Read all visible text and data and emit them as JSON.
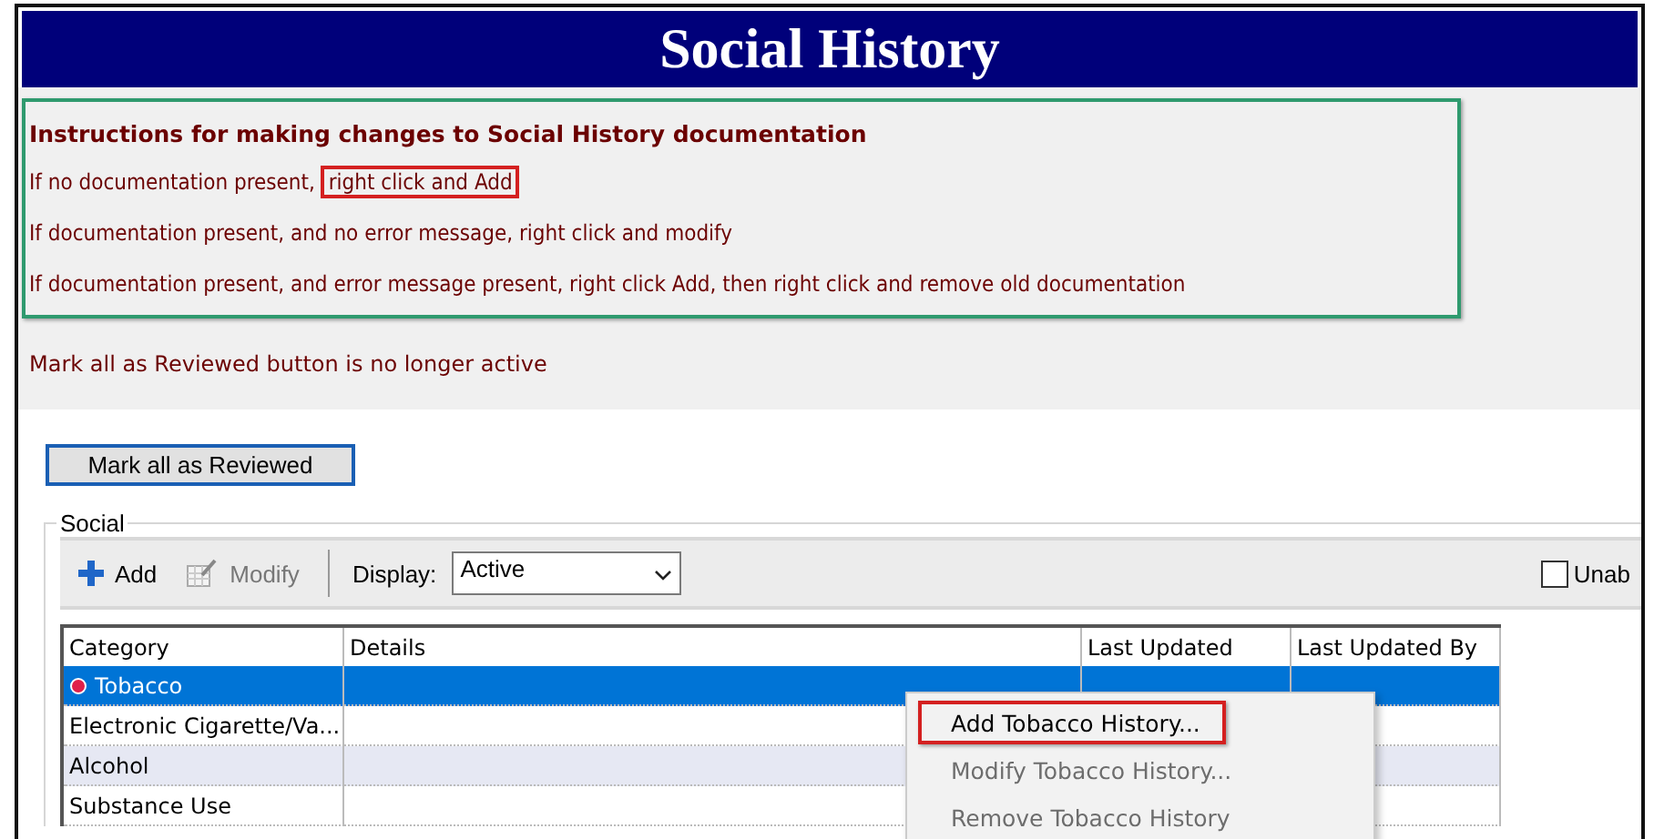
{
  "window": {
    "title": "Social History"
  },
  "instructions": {
    "heading": "Instructions for making changes to Social History documentation",
    "lines": [
      {
        "parts": [
          {
            "text": "If no documentation present, ",
            "highlighted": false
          },
          {
            "text": "right click and Add",
            "highlighted": true
          }
        ]
      },
      {
        "parts": [
          {
            "text": "If documentation present, and no error message, right click and modify",
            "highlighted": false
          }
        ]
      },
      {
        "parts": [
          {
            "text": "If documentation present, and error message present, right click Add, then right click and remove old documentation",
            "highlighted": false
          }
        ]
      }
    ]
  },
  "note": "Mark all as Reviewed button is no longer active",
  "review_button": {
    "label": "Mark all as Reviewed"
  },
  "group": {
    "title": "Social",
    "toolbar": [
      {
        "kind": "add",
        "label": "Add",
        "disabled": false
      },
      {
        "kind": "modify",
        "label": "Modify",
        "disabled": true
      }
    ],
    "display": {
      "label": "Display:",
      "value": "Active"
    },
    "checkbox": {
      "label": "Unab",
      "checked": false
    },
    "table": {
      "columns": [
        "Category",
        "Details",
        "Last Updated",
        "Last Updated By"
      ],
      "rows": [
        {
          "category": "Tobacco",
          "flagged": true,
          "selected": true
        },
        {
          "category": "Electronic Cigarette/Va...",
          "flagged": false,
          "selected": false
        },
        {
          "category": "Alcohol",
          "flagged": false,
          "selected": false
        },
        {
          "category": "Substance Use",
          "flagged": false,
          "selected": false
        }
      ]
    }
  },
  "context_menu": [
    {
      "label": "Add Tobacco History...",
      "disabled": false,
      "highlighted": true
    },
    {
      "label": "Modify Tobacco History...",
      "disabled": true,
      "highlighted": false
    },
    {
      "label": "Remove Tobacco History",
      "disabled": true,
      "highlighted": false
    }
  ]
}
